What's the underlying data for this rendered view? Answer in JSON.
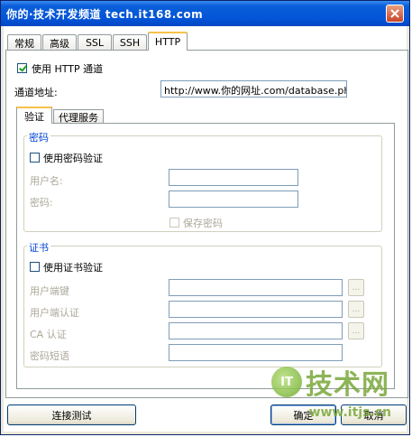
{
  "window": {
    "title": "你的·技术开发频道 tech.it168.com"
  },
  "tabs": [
    "常规",
    "高级",
    "SSL",
    "SSH",
    "HTTP"
  ],
  "http": {
    "use_http_tunnel_label": "使用 HTTP 通道",
    "use_http_tunnel_checked": true,
    "tunnel_address_label": "通道地址:",
    "tunnel_address_value": "http://www.你的网址.com/database.php"
  },
  "inner_tabs": [
    "验证",
    "代理服务"
  ],
  "password_group": {
    "title": "密码",
    "use_password_auth_label": "使用密码验证",
    "username_label": "用户名:",
    "password_label": "密码:",
    "save_password_label": "保存密码"
  },
  "cert_group": {
    "title": "证书",
    "use_cert_auth_label": "使用证书验证",
    "client_key_label": "用户端键",
    "client_cert_label": "用户端认证",
    "ca_cert_label": "CA 认证",
    "passphrase_label": "密码短语",
    "browse_label": "..."
  },
  "buttons": {
    "test_connection": "连接测试",
    "ok": "确定",
    "cancel": "取消"
  },
  "watermark": {
    "logo": "IT",
    "text": "技术网",
    "url": "www.itjs.cn"
  },
  "colors": {
    "titlebar": "#0454d8",
    "group_title": "#0046d5",
    "disabled_text": "#aca899",
    "active_tab_highlight": "#f6c24a"
  }
}
